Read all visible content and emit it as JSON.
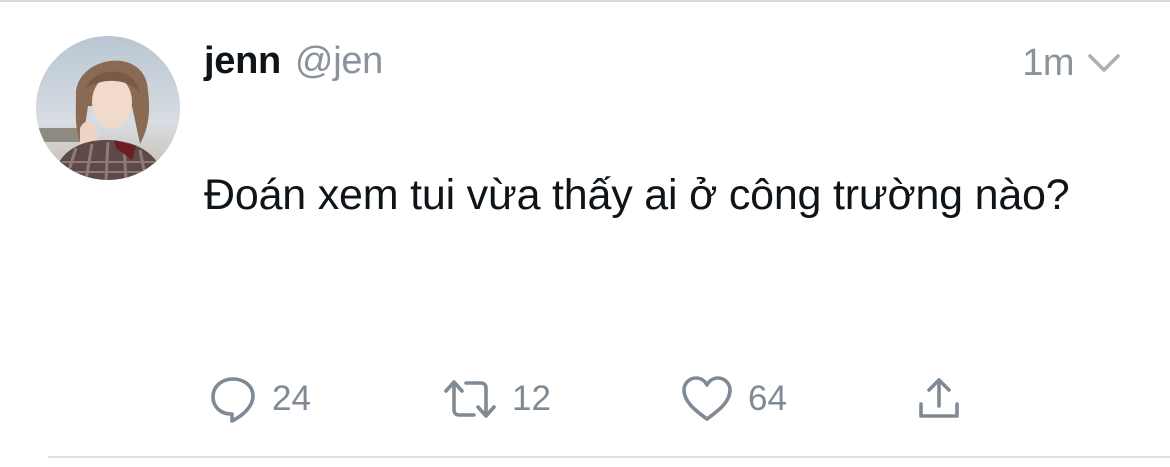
{
  "tweet": {
    "author": {
      "display_name": "jenn",
      "handle": "@jen"
    },
    "timestamp": "1m",
    "text": "Đoán xem tui vừa thấy ai ở công trường nào?",
    "actions": {
      "reply_count": "24",
      "retweet_count": "12",
      "like_count": "64"
    }
  },
  "icons": {
    "reply": "reply-icon",
    "retweet": "retweet-icon",
    "like": "heart-icon",
    "share": "share-icon",
    "menu": "chevron-down-icon"
  },
  "colors": {
    "text_primary": "#0f1419",
    "text_secondary": "#8a939b",
    "icon_gray": "#7f8a94"
  }
}
